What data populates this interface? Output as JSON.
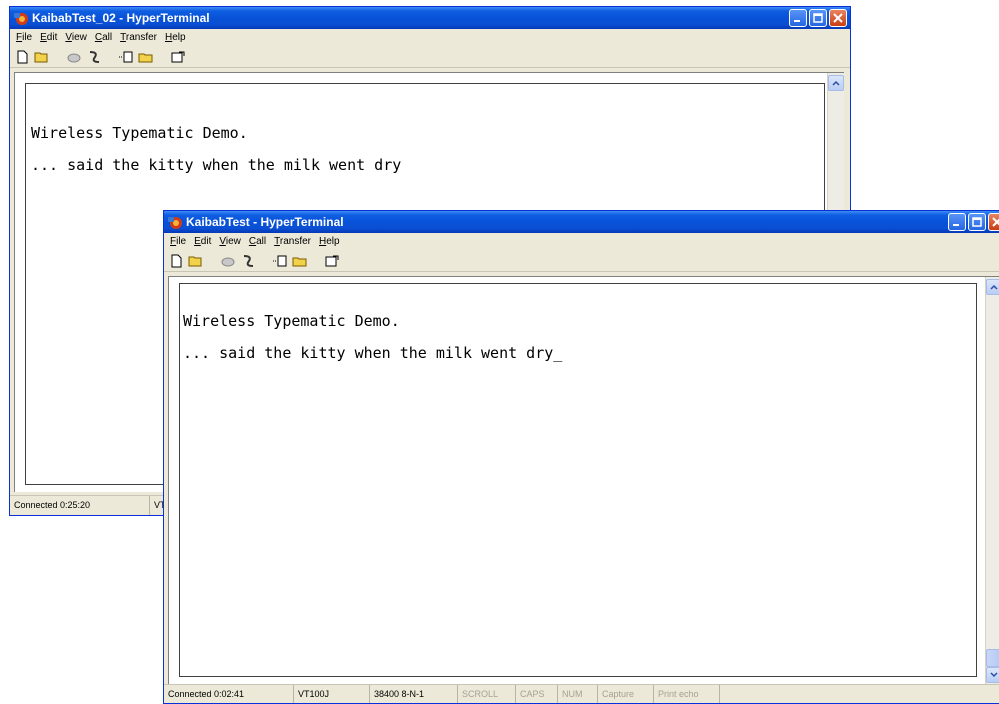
{
  "back_window": {
    "title": "KaibabTest_02 - HyperTerminal",
    "menu": [
      "File",
      "Edit",
      "View",
      "Call",
      "Transfer",
      "Help"
    ],
    "menu_underline": [
      "F",
      "E",
      "V",
      "C",
      "T",
      "H"
    ],
    "terminal_lines": [
      "Wireless Typematic Demo.",
      "... said the kitty when the milk went dry"
    ],
    "status": {
      "connected": "Connected 0:25:20",
      "emulation": "VT"
    }
  },
  "front_window": {
    "title": "KaibabTest - HyperTerminal",
    "menu": [
      "File",
      "Edit",
      "View",
      "Call",
      "Transfer",
      "Help"
    ],
    "terminal_lines": [
      "Wireless Typematic Demo.",
      "... said the kitty when the milk went dry_"
    ],
    "status": {
      "connected": "Connected 0:02:41",
      "emulation": "VT100J",
      "port": "38400 8-N-1",
      "scroll": "SCROLL",
      "caps": "CAPS",
      "num": "NUM",
      "capture": "Capture",
      "print_echo": "Print echo"
    }
  },
  "toolbar_icons": [
    "new-icon",
    "open-icon",
    "disconnect-icon",
    "dial-icon",
    "send-icon",
    "receive-icon",
    "properties-icon"
  ],
  "colors": {
    "title_bar": "#0a4fd3",
    "close_button": "#c93d14",
    "window_face": "#ece9d8"
  }
}
